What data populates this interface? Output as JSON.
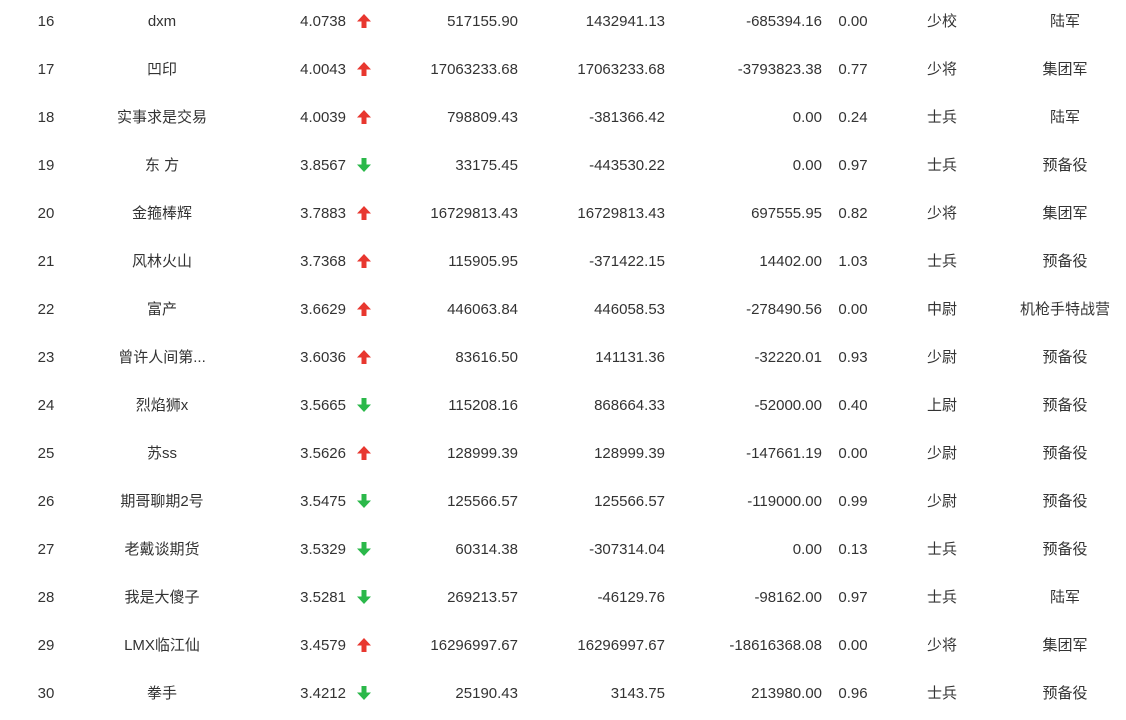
{
  "colors": {
    "up": "#e8372f",
    "down": "#2bb84a",
    "text": "#333333"
  },
  "rows": [
    {
      "rank": "16",
      "name": "dxm",
      "score": "4.0738",
      "trend": "up",
      "v1": "517155.90",
      "v2": "1432941.13",
      "v3": "-685394.16",
      "ratio": "0.00",
      "title": "少校",
      "unit": "陆军"
    },
    {
      "rank": "17",
      "name": "凹印",
      "score": "4.0043",
      "trend": "up",
      "v1": "17063233.68",
      "v2": "17063233.68",
      "v3": "-3793823.38",
      "ratio": "0.77",
      "title": "少将",
      "unit": "集团军"
    },
    {
      "rank": "18",
      "name": "实事求是交易",
      "score": "4.0039",
      "trend": "up",
      "v1": "798809.43",
      "v2": "-381366.42",
      "v3": "0.00",
      "ratio": "0.24",
      "title": "士兵",
      "unit": "陆军"
    },
    {
      "rank": "19",
      "name": "东 方",
      "score": "3.8567",
      "trend": "down",
      "v1": "33175.45",
      "v2": "-443530.22",
      "v3": "0.00",
      "ratio": "0.97",
      "title": "士兵",
      "unit": "预备役"
    },
    {
      "rank": "20",
      "name": "金箍棒辉",
      "score": "3.7883",
      "trend": "up",
      "v1": "16729813.43",
      "v2": "16729813.43",
      "v3": "697555.95",
      "ratio": "0.82",
      "title": "少将",
      "unit": "集团军"
    },
    {
      "rank": "21",
      "name": "风林火山",
      "score": "3.7368",
      "trend": "up",
      "v1": "115905.95",
      "v2": "-371422.15",
      "v3": "14402.00",
      "ratio": "1.03",
      "title": "士兵",
      "unit": "预备役"
    },
    {
      "rank": "22",
      "name": "富产",
      "score": "3.6629",
      "trend": "up",
      "v1": "446063.84",
      "v2": "446058.53",
      "v3": "-278490.56",
      "ratio": "0.00",
      "title": "中尉",
      "unit": "机枪手特战营"
    },
    {
      "rank": "23",
      "name": "曾许人间第...",
      "score": "3.6036",
      "trend": "up",
      "v1": "83616.50",
      "v2": "141131.36",
      "v3": "-32220.01",
      "ratio": "0.93",
      "title": "少尉",
      "unit": "预备役"
    },
    {
      "rank": "24",
      "name": "烈焰狮x",
      "score": "3.5665",
      "trend": "down",
      "v1": "115208.16",
      "v2": "868664.33",
      "v3": "-52000.00",
      "ratio": "0.40",
      "title": "上尉",
      "unit": "预备役"
    },
    {
      "rank": "25",
      "name": "苏ss",
      "score": "3.5626",
      "trend": "up",
      "v1": "128999.39",
      "v2": "128999.39",
      "v3": "-147661.19",
      "ratio": "0.00",
      "title": "少尉",
      "unit": "预备役"
    },
    {
      "rank": "26",
      "name": "期哥聊期2号",
      "score": "3.5475",
      "trend": "down",
      "v1": "125566.57",
      "v2": "125566.57",
      "v3": "-119000.00",
      "ratio": "0.99",
      "title": "少尉",
      "unit": "预备役"
    },
    {
      "rank": "27",
      "name": "老戴谈期货",
      "score": "3.5329",
      "trend": "down",
      "v1": "60314.38",
      "v2": "-307314.04",
      "v3": "0.00",
      "ratio": "0.13",
      "title": "士兵",
      "unit": "预备役"
    },
    {
      "rank": "28",
      "name": "我是大傻子",
      "score": "3.5281",
      "trend": "down",
      "v1": "269213.57",
      "v2": "-46129.76",
      "v3": "-98162.00",
      "ratio": "0.97",
      "title": "士兵",
      "unit": "陆军"
    },
    {
      "rank": "29",
      "name": "LMX临江仙",
      "score": "3.4579",
      "trend": "up",
      "v1": "16296997.67",
      "v2": "16296997.67",
      "v3": "-18616368.08",
      "ratio": "0.00",
      "title": "少将",
      "unit": "集团军"
    },
    {
      "rank": "30",
      "name": "拳手",
      "score": "3.4212",
      "trend": "down",
      "v1": "25190.43",
      "v2": "3143.75",
      "v3": "213980.00",
      "ratio": "0.96",
      "title": "士兵",
      "unit": "预备役"
    }
  ]
}
